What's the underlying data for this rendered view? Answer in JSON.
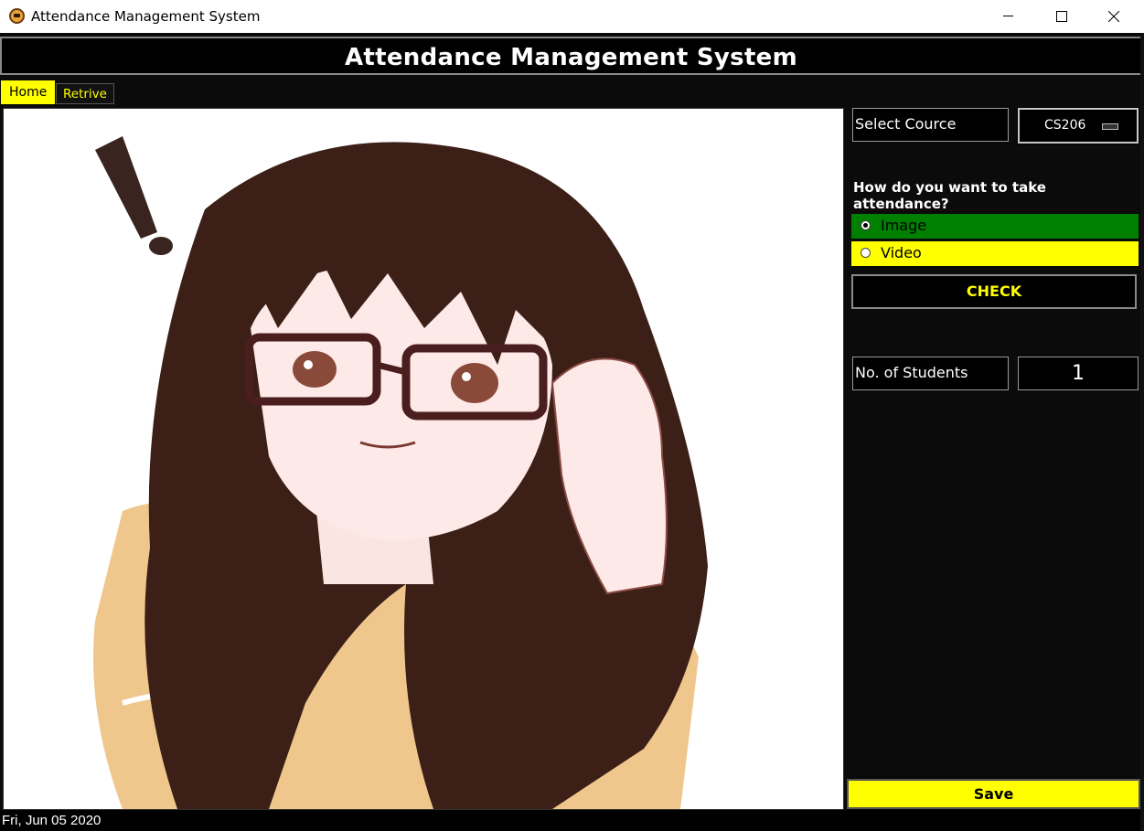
{
  "window": {
    "title": "Attendance Management System",
    "icon": "app-logo-icon"
  },
  "header": {
    "title": "Attendance Management System"
  },
  "tabs": [
    {
      "label": "Home",
      "active": true
    },
    {
      "label": "Retrive",
      "active": false
    }
  ],
  "panel": {
    "course_label": "Select Cource",
    "course_value": "CS206",
    "question": "How do you want to take attendance?",
    "options": [
      {
        "label": "Image",
        "selected": true,
        "color": "#008000"
      },
      {
        "label": "Video",
        "selected": false,
        "color": "#ffff00"
      }
    ],
    "check_label": "CHECK",
    "students_label": "No. of Students",
    "students_value": "1",
    "save_label": "Save"
  },
  "status": {
    "date": "Fri, Jun 05 2020"
  },
  "colors": {
    "accent": "#ffff00",
    "background": "#0b0b0b",
    "selected_option": "#008000"
  }
}
